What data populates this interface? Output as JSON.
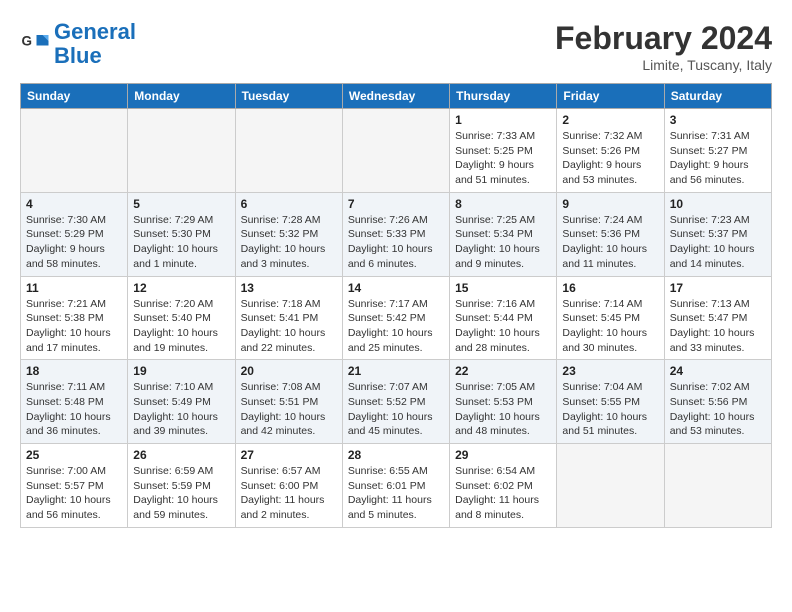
{
  "header": {
    "logo_line1": "General",
    "logo_line2": "Blue",
    "month_title": "February 2024",
    "location": "Limite, Tuscany, Italy"
  },
  "days_of_week": [
    "Sunday",
    "Monday",
    "Tuesday",
    "Wednesday",
    "Thursday",
    "Friday",
    "Saturday"
  ],
  "weeks": [
    [
      {
        "num": "",
        "info": ""
      },
      {
        "num": "",
        "info": ""
      },
      {
        "num": "",
        "info": ""
      },
      {
        "num": "",
        "info": ""
      },
      {
        "num": "1",
        "info": "Sunrise: 7:33 AM\nSunset: 5:25 PM\nDaylight: 9 hours\nand 51 minutes."
      },
      {
        "num": "2",
        "info": "Sunrise: 7:32 AM\nSunset: 5:26 PM\nDaylight: 9 hours\nand 53 minutes."
      },
      {
        "num": "3",
        "info": "Sunrise: 7:31 AM\nSunset: 5:27 PM\nDaylight: 9 hours\nand 56 minutes."
      }
    ],
    [
      {
        "num": "4",
        "info": "Sunrise: 7:30 AM\nSunset: 5:29 PM\nDaylight: 9 hours\nand 58 minutes."
      },
      {
        "num": "5",
        "info": "Sunrise: 7:29 AM\nSunset: 5:30 PM\nDaylight: 10 hours\nand 1 minute."
      },
      {
        "num": "6",
        "info": "Sunrise: 7:28 AM\nSunset: 5:32 PM\nDaylight: 10 hours\nand 3 minutes."
      },
      {
        "num": "7",
        "info": "Sunrise: 7:26 AM\nSunset: 5:33 PM\nDaylight: 10 hours\nand 6 minutes."
      },
      {
        "num": "8",
        "info": "Sunrise: 7:25 AM\nSunset: 5:34 PM\nDaylight: 10 hours\nand 9 minutes."
      },
      {
        "num": "9",
        "info": "Sunrise: 7:24 AM\nSunset: 5:36 PM\nDaylight: 10 hours\nand 11 minutes."
      },
      {
        "num": "10",
        "info": "Sunrise: 7:23 AM\nSunset: 5:37 PM\nDaylight: 10 hours\nand 14 minutes."
      }
    ],
    [
      {
        "num": "11",
        "info": "Sunrise: 7:21 AM\nSunset: 5:38 PM\nDaylight: 10 hours\nand 17 minutes."
      },
      {
        "num": "12",
        "info": "Sunrise: 7:20 AM\nSunset: 5:40 PM\nDaylight: 10 hours\nand 19 minutes."
      },
      {
        "num": "13",
        "info": "Sunrise: 7:18 AM\nSunset: 5:41 PM\nDaylight: 10 hours\nand 22 minutes."
      },
      {
        "num": "14",
        "info": "Sunrise: 7:17 AM\nSunset: 5:42 PM\nDaylight: 10 hours\nand 25 minutes."
      },
      {
        "num": "15",
        "info": "Sunrise: 7:16 AM\nSunset: 5:44 PM\nDaylight: 10 hours\nand 28 minutes."
      },
      {
        "num": "16",
        "info": "Sunrise: 7:14 AM\nSunset: 5:45 PM\nDaylight: 10 hours\nand 30 minutes."
      },
      {
        "num": "17",
        "info": "Sunrise: 7:13 AM\nSunset: 5:47 PM\nDaylight: 10 hours\nand 33 minutes."
      }
    ],
    [
      {
        "num": "18",
        "info": "Sunrise: 7:11 AM\nSunset: 5:48 PM\nDaylight: 10 hours\nand 36 minutes."
      },
      {
        "num": "19",
        "info": "Sunrise: 7:10 AM\nSunset: 5:49 PM\nDaylight: 10 hours\nand 39 minutes."
      },
      {
        "num": "20",
        "info": "Sunrise: 7:08 AM\nSunset: 5:51 PM\nDaylight: 10 hours\nand 42 minutes."
      },
      {
        "num": "21",
        "info": "Sunrise: 7:07 AM\nSunset: 5:52 PM\nDaylight: 10 hours\nand 45 minutes."
      },
      {
        "num": "22",
        "info": "Sunrise: 7:05 AM\nSunset: 5:53 PM\nDaylight: 10 hours\nand 48 minutes."
      },
      {
        "num": "23",
        "info": "Sunrise: 7:04 AM\nSunset: 5:55 PM\nDaylight: 10 hours\nand 51 minutes."
      },
      {
        "num": "24",
        "info": "Sunrise: 7:02 AM\nSunset: 5:56 PM\nDaylight: 10 hours\nand 53 minutes."
      }
    ],
    [
      {
        "num": "25",
        "info": "Sunrise: 7:00 AM\nSunset: 5:57 PM\nDaylight: 10 hours\nand 56 minutes."
      },
      {
        "num": "26",
        "info": "Sunrise: 6:59 AM\nSunset: 5:59 PM\nDaylight: 10 hours\nand 59 minutes."
      },
      {
        "num": "27",
        "info": "Sunrise: 6:57 AM\nSunset: 6:00 PM\nDaylight: 11 hours\nand 2 minutes."
      },
      {
        "num": "28",
        "info": "Sunrise: 6:55 AM\nSunset: 6:01 PM\nDaylight: 11 hours\nand 5 minutes."
      },
      {
        "num": "29",
        "info": "Sunrise: 6:54 AM\nSunset: 6:02 PM\nDaylight: 11 hours\nand 8 minutes."
      },
      {
        "num": "",
        "info": ""
      },
      {
        "num": "",
        "info": ""
      }
    ]
  ]
}
